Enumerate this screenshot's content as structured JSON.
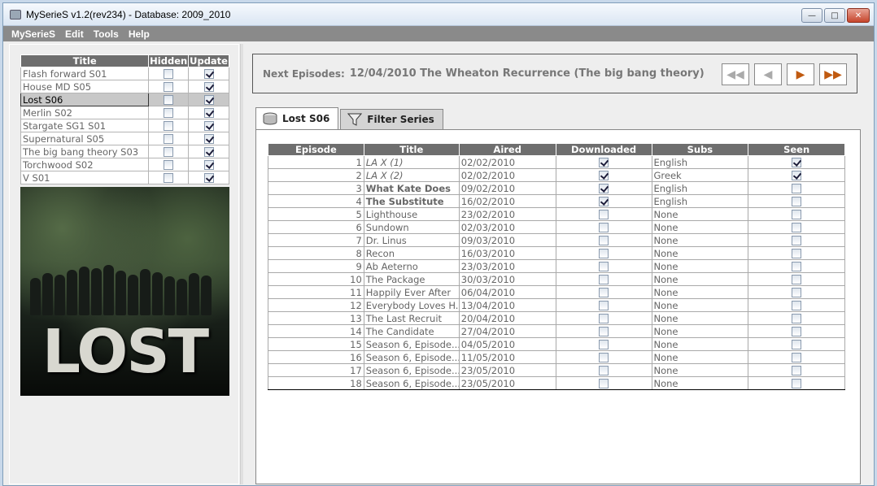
{
  "window": {
    "title": "MySerieS v1.2(rev234) - Database: 2009_2010"
  },
  "menu": [
    "MySerieS",
    "Edit",
    "Tools",
    "Help"
  ],
  "series_table": {
    "headers": [
      "Title",
      "Hidden",
      "Update"
    ],
    "rows": [
      {
        "title": "Flash forward S01",
        "hidden": false,
        "update": true,
        "selected": false
      },
      {
        "title": "House MD S05",
        "hidden": false,
        "update": true,
        "selected": false
      },
      {
        "title": "Lost S06",
        "hidden": false,
        "update": true,
        "selected": true
      },
      {
        "title": "Merlin S02",
        "hidden": false,
        "update": true,
        "selected": false
      },
      {
        "title": "Stargate SG1 S01",
        "hidden": false,
        "update": true,
        "selected": false
      },
      {
        "title": "Supernatural S05",
        "hidden": false,
        "update": true,
        "selected": false
      },
      {
        "title": "The big bang theory S03",
        "hidden": false,
        "update": true,
        "selected": false
      },
      {
        "title": "Torchwood S02",
        "hidden": false,
        "update": true,
        "selected": false
      },
      {
        "title": "V S01",
        "hidden": false,
        "update": true,
        "selected": false
      }
    ]
  },
  "poster": {
    "logo_text": "LOST"
  },
  "next_episodes": {
    "label": "Next Episodes:",
    "value": "12/04/2010 The Wheaton Recurrence (The big bang theory)"
  },
  "nav_buttons": [
    "first-icon",
    "prev-icon",
    "next-icon",
    "last-icon"
  ],
  "tabs": [
    {
      "label": "Lost S06",
      "icon": "disk-icon",
      "active": true
    },
    {
      "label": "Filter Series",
      "icon": "funnel-icon",
      "active": false
    }
  ],
  "episodes_table": {
    "headers": [
      "Episode",
      "Title",
      "Aired",
      "Downloaded",
      "Subs",
      "Seen"
    ],
    "rows": [
      {
        "episode": "1",
        "title": "LA X (1)",
        "style": "italic",
        "aired": "02/02/2010",
        "downloaded": true,
        "subs": "English",
        "seen": true
      },
      {
        "episode": "2",
        "title": "LA X (2)",
        "style": "italic",
        "aired": "02/02/2010",
        "downloaded": true,
        "subs": "Greek",
        "seen": true
      },
      {
        "episode": "3",
        "title": "What Kate Does",
        "style": "bold",
        "aired": "09/02/2010",
        "downloaded": true,
        "subs": "English",
        "seen": false
      },
      {
        "episode": "4",
        "title": "The Substitute",
        "style": "bold",
        "aired": "16/02/2010",
        "downloaded": true,
        "subs": "English",
        "seen": false
      },
      {
        "episode": "5",
        "title": "Lighthouse",
        "style": "normal",
        "aired": "23/02/2010",
        "downloaded": false,
        "subs": "None",
        "seen": false
      },
      {
        "episode": "6",
        "title": "Sundown",
        "style": "normal",
        "aired": "02/03/2010",
        "downloaded": false,
        "subs": "None",
        "seen": false
      },
      {
        "episode": "7",
        "title": "Dr. Linus",
        "style": "normal",
        "aired": "09/03/2010",
        "downloaded": false,
        "subs": "None",
        "seen": false
      },
      {
        "episode": "8",
        "title": "Recon",
        "style": "normal",
        "aired": "16/03/2010",
        "downloaded": false,
        "subs": "None",
        "seen": false
      },
      {
        "episode": "9",
        "title": "Ab Aeterno",
        "style": "normal",
        "aired": "23/03/2010",
        "downloaded": false,
        "subs": "None",
        "seen": false
      },
      {
        "episode": "10",
        "title": "The Package",
        "style": "normal",
        "aired": "30/03/2010",
        "downloaded": false,
        "subs": "None",
        "seen": false
      },
      {
        "episode": "11",
        "title": "Happily Ever After",
        "style": "normal",
        "aired": "06/04/2010",
        "downloaded": false,
        "subs": "None",
        "seen": false
      },
      {
        "episode": "12",
        "title": "Everybody Loves H...",
        "style": "normal",
        "aired": "13/04/2010",
        "downloaded": false,
        "subs": "None",
        "seen": false
      },
      {
        "episode": "13",
        "title": "The Last Recruit",
        "style": "normal",
        "aired": "20/04/2010",
        "downloaded": false,
        "subs": "None",
        "seen": false
      },
      {
        "episode": "14",
        "title": "The Candidate",
        "style": "normal",
        "aired": "27/04/2010",
        "downloaded": false,
        "subs": "None",
        "seen": false
      },
      {
        "episode": "15",
        "title": "Season 6, Episode...",
        "style": "normal",
        "aired": "04/05/2010",
        "downloaded": false,
        "subs": "None",
        "seen": false
      },
      {
        "episode": "16",
        "title": "Season 6, Episode...",
        "style": "normal",
        "aired": "11/05/2010",
        "downloaded": false,
        "subs": "None",
        "seen": false
      },
      {
        "episode": "17",
        "title": "Season 6, Episode...",
        "style": "normal",
        "aired": "23/05/2010",
        "downloaded": false,
        "subs": "None",
        "seen": false
      },
      {
        "episode": "18",
        "title": "Season 6, Episode...",
        "style": "normal",
        "aired": "23/05/2010",
        "downloaded": false,
        "subs": "None",
        "seen": false
      }
    ]
  }
}
